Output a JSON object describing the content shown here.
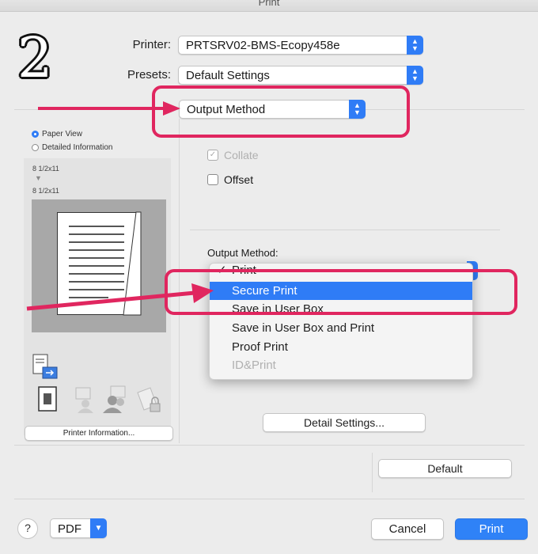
{
  "window": {
    "title": "Print"
  },
  "step_number": "2",
  "printer": {
    "label": "Printer:",
    "value": "PRTSRV02-BMS-Ecopy458e"
  },
  "presets": {
    "label": "Presets:",
    "value": "Default Settings"
  },
  "section_popup": {
    "value": "Output Method"
  },
  "preview": {
    "view_options": [
      "Paper View",
      "Detailed Information"
    ],
    "selected_view": "Paper View",
    "paper_size_top": "8 1/2x11",
    "paper_size_bottom": "8 1/2x11",
    "printer_info_button": "Printer Information..."
  },
  "options": {
    "collate_label": "Collate",
    "offset_label": "Offset",
    "output_method_label": "Output Method:"
  },
  "output_menu": {
    "items": [
      {
        "label": "Print",
        "checked": true,
        "state": "normal"
      },
      {
        "label": "Secure Print",
        "state": "selected"
      },
      {
        "label": "Save in User Box",
        "state": "normal"
      },
      {
        "label": "Save in User Box and Print",
        "state": "normal"
      },
      {
        "label": "Proof Print",
        "state": "normal"
      },
      {
        "label": "ID&Print",
        "state": "disabled"
      }
    ]
  },
  "buttons": {
    "detail_settings": "Detail Settings...",
    "default": "Default",
    "pdf": "PDF",
    "cancel": "Cancel",
    "print": "Print",
    "help": "?"
  },
  "colors": {
    "accent": "#2f7cf6",
    "annotation": "#e0265f"
  }
}
